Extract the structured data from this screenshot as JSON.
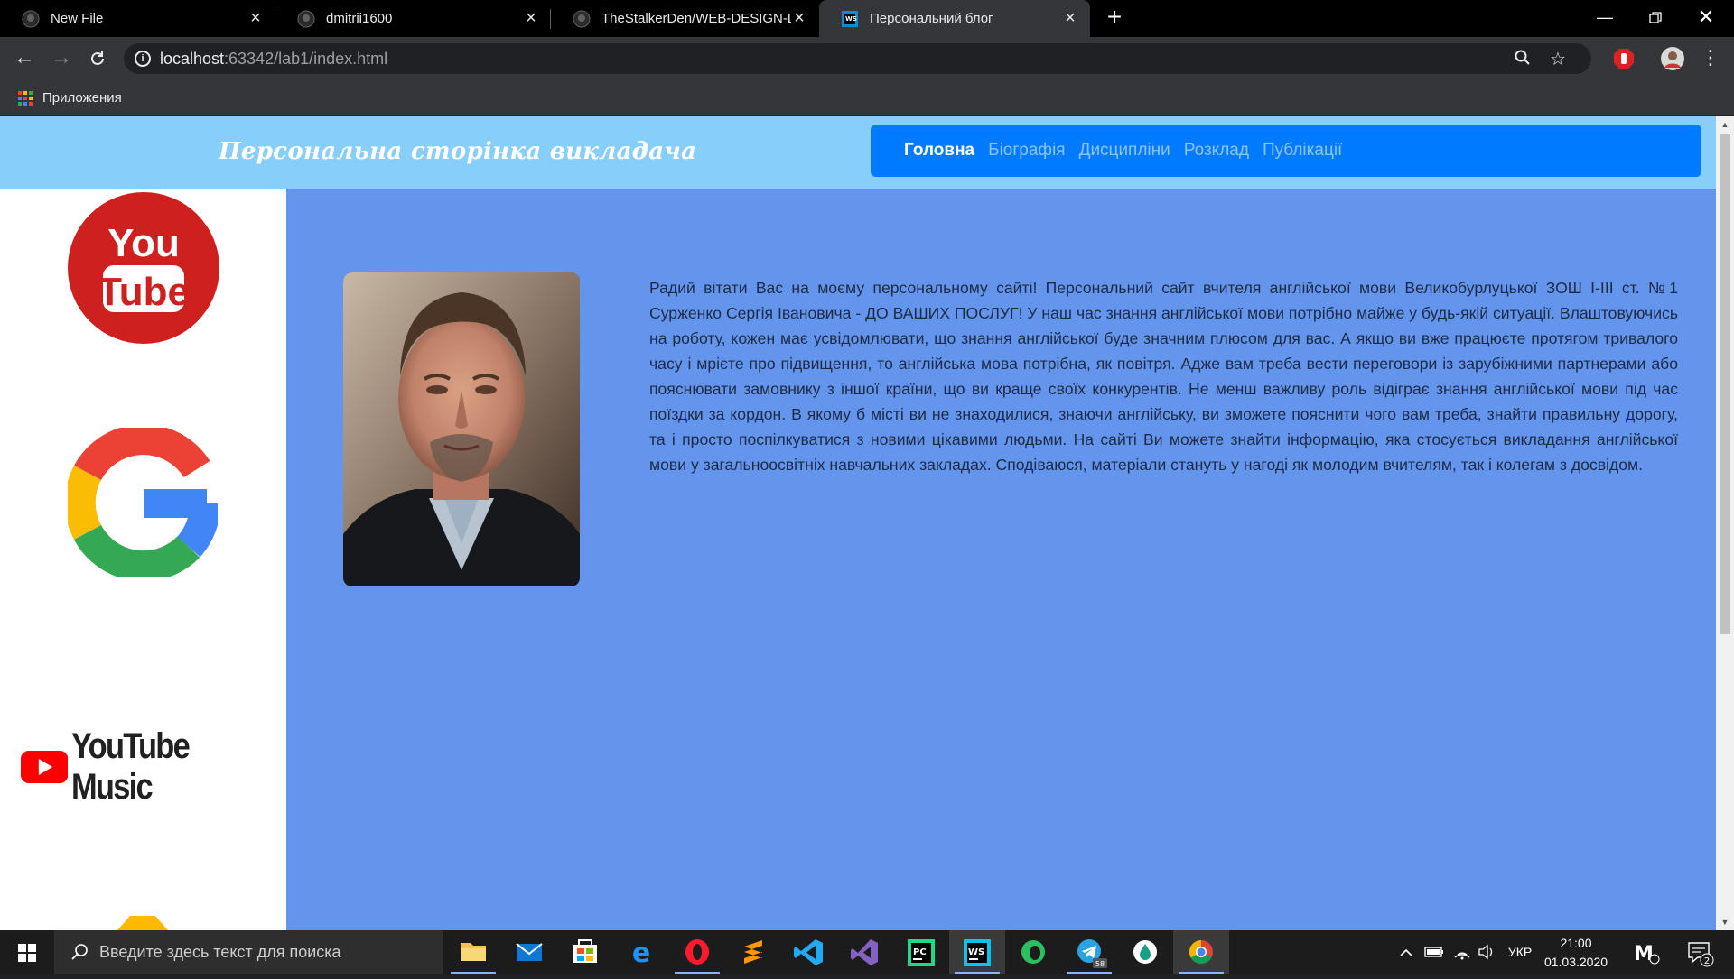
{
  "browser": {
    "tabs": [
      {
        "title": "New File",
        "active": false
      },
      {
        "title": "dmitrii1600",
        "active": false
      },
      {
        "title": "TheStalkerDen/WEB-DESIGN-Lab",
        "active": false
      },
      {
        "title": "Персональний блог",
        "active": true
      }
    ],
    "new_tab_label": "+",
    "address": {
      "host": "localhost",
      "rest": ":63342/lab1/index.html"
    },
    "bookmarks": {
      "apps_label": "Приложения"
    }
  },
  "page": {
    "site_title": "Персональна сторінка викладача",
    "nav": [
      {
        "label": "Головна",
        "active": true
      },
      {
        "label": "Біографія",
        "active": false
      },
      {
        "label": "Дисципліни",
        "active": false
      },
      {
        "label": "Розклад",
        "active": false
      },
      {
        "label": "Публікації",
        "active": false
      }
    ],
    "sidebar_logos": [
      "youtube-logo",
      "google-logo",
      "youtube-music-logo",
      "google-drive-logo"
    ],
    "youtube_logo_text": {
      "line1": "You",
      "line2": "Tube"
    },
    "youtube_music_text": "YouTube Music",
    "bio_text": "Радий вітати Вас на моєму персональному сайті! Персональний сайт вчителя англійської мови Великобурлуцької ЗОШ І-ІІІ ст. №1 Сурженко Сергія Івановича - ДО ВАШИХ ПОСЛУГ! У наш час знання англійської мови потрібно майже у будь-якій ситуації. Влаштовуючись на роботу, кожен має усвідомлювати, що знання англійської буде значним плюсом для вас. А якщо ви вже працюєте протягом тривалого часу і мрієте про підвищення, то англійська мова потрібна, як повітря. Адже вам треба вести переговори із зарубіжними партнерами або пояснювати замовнику з іншої країни, що ви краще своїх конкурентів. Не менш важливу роль відіграє знання англійської мови під час поїздки за кордон. В якому б місті ви не знаходилися, знаючи англійську, ви зможете пояснити чого вам треба, знайти правильну дорогу, та і просто поспілкуватися з новими цікавими людьми. На сайті Ви можете знайти інформацію, яка стосується викладання англійської мови у загальноосвітніх навчальних закладах. Сподіваюся, матеріали стануть у нагоді як молодим вчителям, так і колегам з досвідом."
  },
  "taskbar": {
    "search_placeholder": "Введите здесь текст для поиска",
    "apps": [
      "file-explorer",
      "mail",
      "store",
      "edge",
      "opera",
      "sublime-text",
      "vscode",
      "visual-studio",
      "pycharm",
      "webstorm",
      "evernote",
      "telegram",
      "app-drop",
      "chrome"
    ],
    "telegram_badge": "58",
    "language": "УКР",
    "time": "21:00",
    "date": "01.03.2020",
    "notification_count": "2",
    "colors": {
      "accent": "#8ab4f8"
    }
  },
  "colors": {
    "page_bg": "#6495ed",
    "header_bg": "#87cefa",
    "nav_bg": "#007bff",
    "sidebar_bg": "#ffffff"
  }
}
